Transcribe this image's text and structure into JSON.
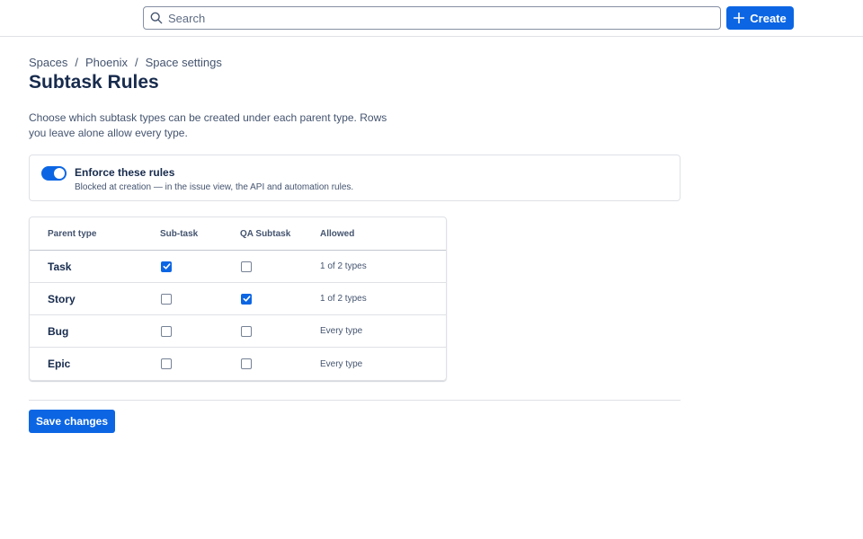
{
  "header": {
    "search_placeholder": "Search",
    "create_label": "Create"
  },
  "breadcrumb": {
    "items": [
      "Spaces",
      "Phoenix",
      "Space settings"
    ],
    "separator": "/"
  },
  "page": {
    "title": "Subtask Rules",
    "description": "Choose which subtask types can be created under each parent type. Rows you leave alone allow every type."
  },
  "enforce": {
    "enabled": true,
    "title": "Enforce these rules",
    "subtitle": "Blocked at creation — in the issue view, the API and automation rules."
  },
  "table": {
    "headers": [
      "Parent type",
      "Sub-task",
      "QA Subtask",
      "Allowed"
    ],
    "rows": [
      {
        "parent": "Task",
        "subtask": true,
        "qa_subtask": false,
        "allowed": "1 of 2 types"
      },
      {
        "parent": "Story",
        "subtask": false,
        "qa_subtask": true,
        "allowed": "1 of 2 types"
      },
      {
        "parent": "Bug",
        "subtask": false,
        "qa_subtask": false,
        "allowed": "Every type"
      },
      {
        "parent": "Epic",
        "subtask": false,
        "qa_subtask": false,
        "allowed": "Every type"
      }
    ]
  },
  "footer": {
    "save_label": "Save changes"
  },
  "colors": {
    "accent": "#0c66e4",
    "text": "#172b4d",
    "subtle_text": "#44546f",
    "border": "#dfe1e6"
  }
}
